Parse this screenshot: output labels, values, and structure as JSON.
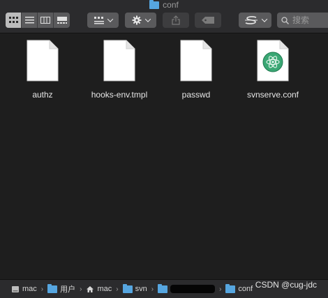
{
  "window": {
    "title": "conf"
  },
  "toolbar": {
    "view_modes": [
      "icon-view-icon",
      "list-view-icon",
      "column-view-icon",
      "gallery-view-icon"
    ],
    "active_view": 0,
    "search_placeholder": "搜索"
  },
  "files": [
    {
      "name": "authz",
      "icon": "blank-document-icon"
    },
    {
      "name": "hooks-env.tmpl",
      "icon": "blank-document-icon"
    },
    {
      "name": "passwd",
      "icon": "blank-document-icon"
    },
    {
      "name": "svnserve.conf",
      "icon": "atom-document-icon"
    }
  ],
  "path": {
    "items": [
      {
        "label": "mac",
        "icon": "disk-icon"
      },
      {
        "label": "用户",
        "icon": "folder-icon"
      },
      {
        "label": "mac",
        "icon": "home-icon"
      },
      {
        "label": "svn",
        "icon": "folder-icon"
      },
      {
        "label": "",
        "icon": "folder-icon",
        "redacted": true
      },
      {
        "label": "conf",
        "icon": "folder-icon"
      }
    ]
  },
  "watermark": "CSDN @cug-jdc",
  "colors": {
    "folder": "#56a6e0",
    "atom_green": "#3aa774",
    "background": "#1e1e1e"
  }
}
